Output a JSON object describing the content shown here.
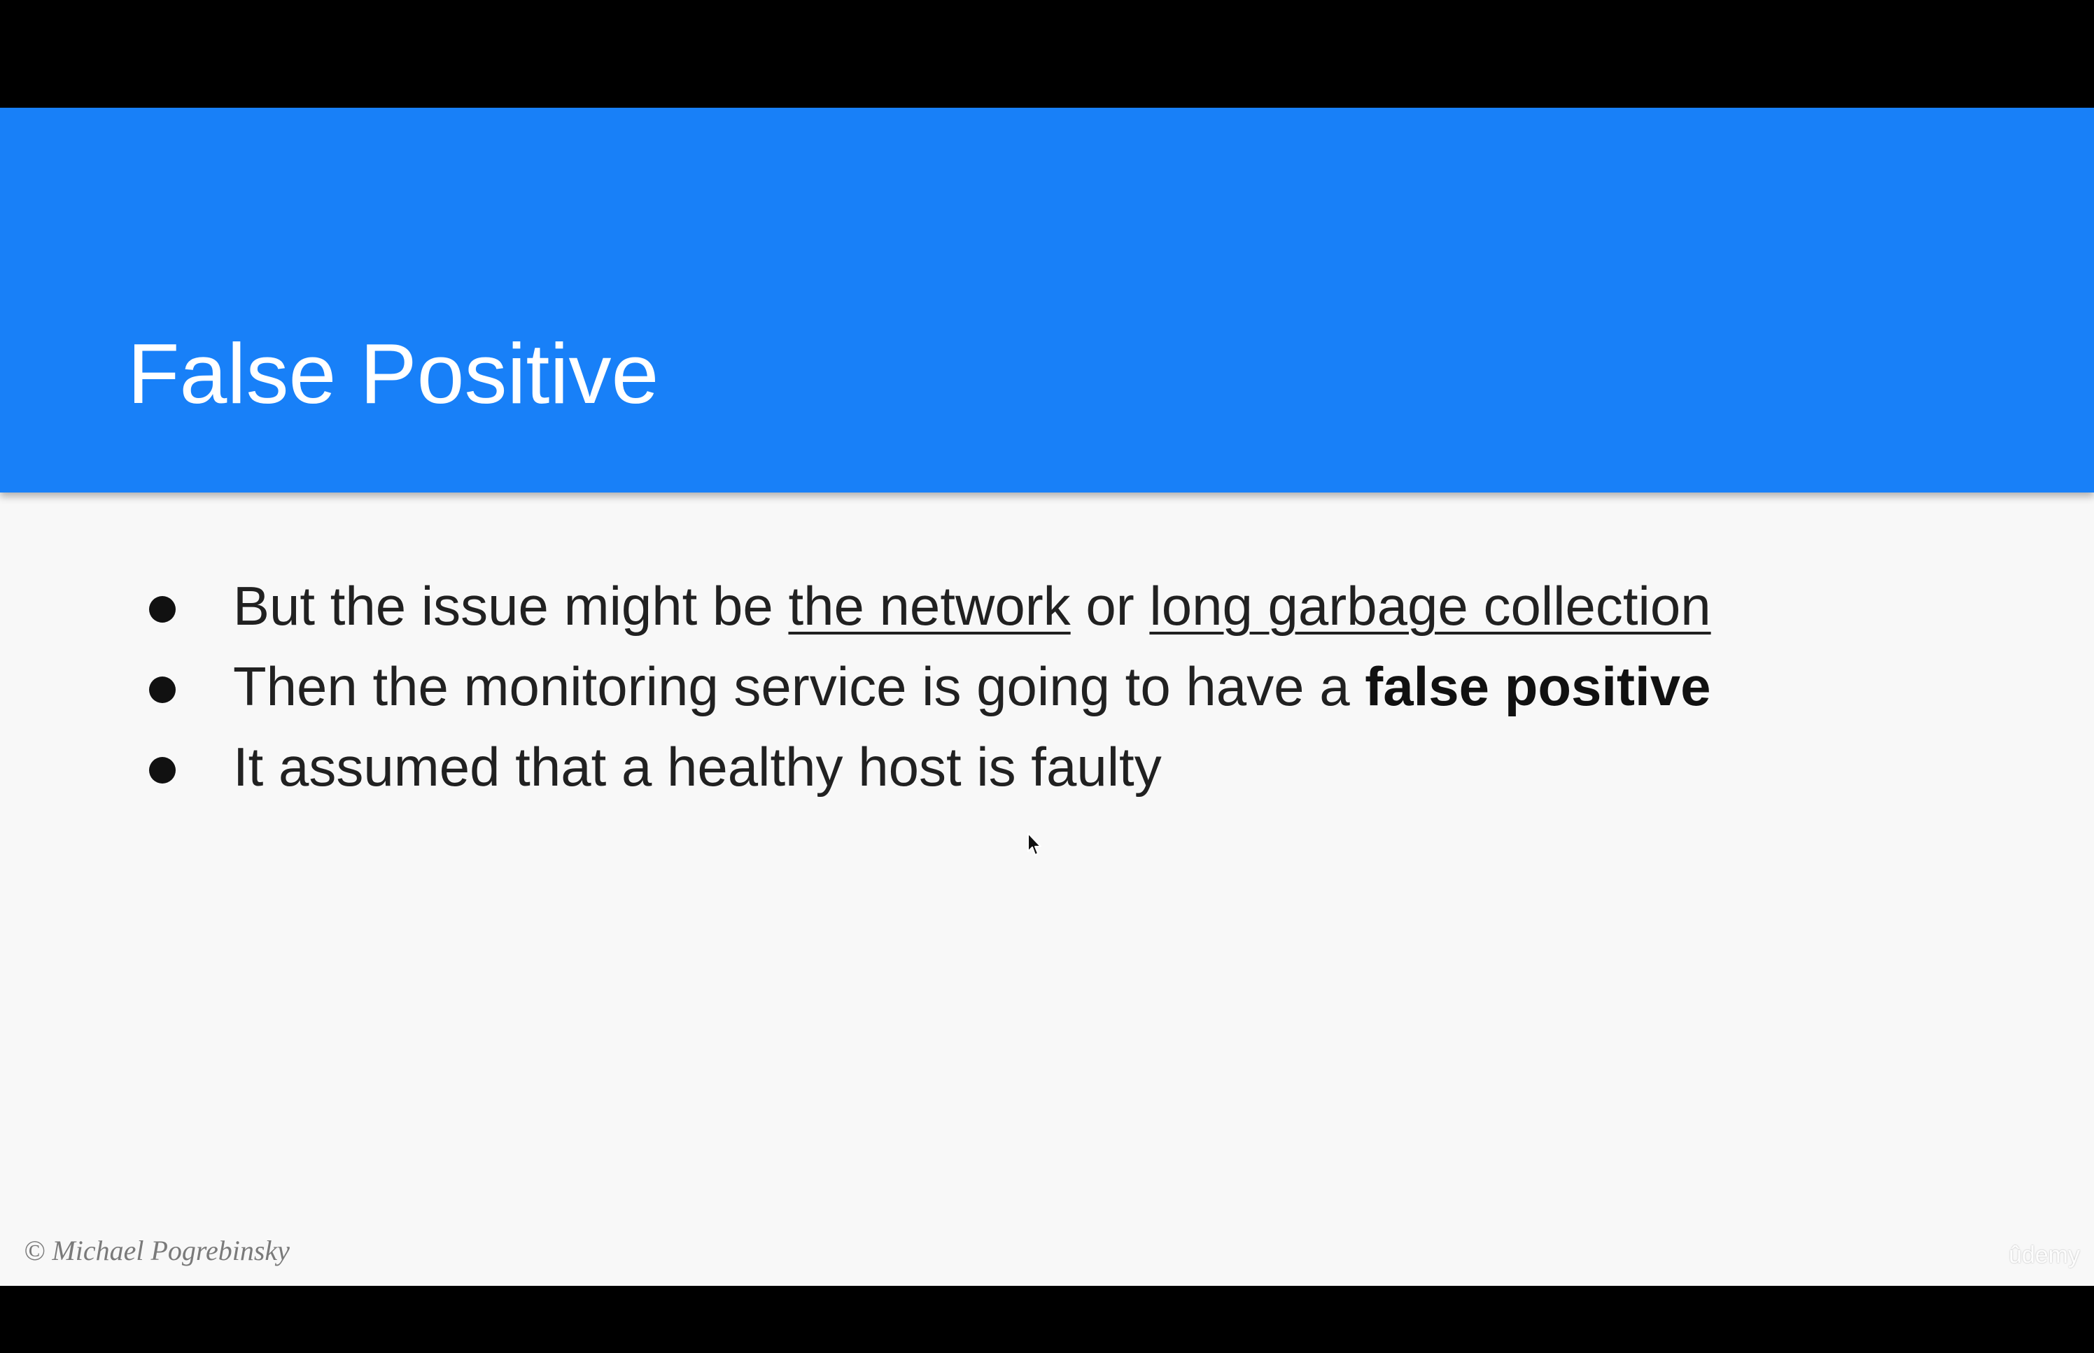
{
  "slide": {
    "title": "False Positive",
    "title_bar_color": "#1880f8",
    "background_color": "#f8f8f8",
    "bullets": [
      {
        "parts": {
          "p1": "But the issue might be ",
          "u1": "the network",
          "p2": " or ",
          "u2": "long garbage collection"
        }
      },
      {
        "parts": {
          "p1": "Then the monitoring service is going to have a ",
          "b1": "false positive"
        }
      },
      {
        "parts": {
          "p1": "It assumed that a healthy host is faulty"
        }
      }
    ],
    "copyright": "© Michael Pogrebinsky"
  },
  "watermark": "ûdemy",
  "icons": {
    "bullet": "bullet-dot-icon",
    "cursor": "mouse-pointer-icon"
  }
}
